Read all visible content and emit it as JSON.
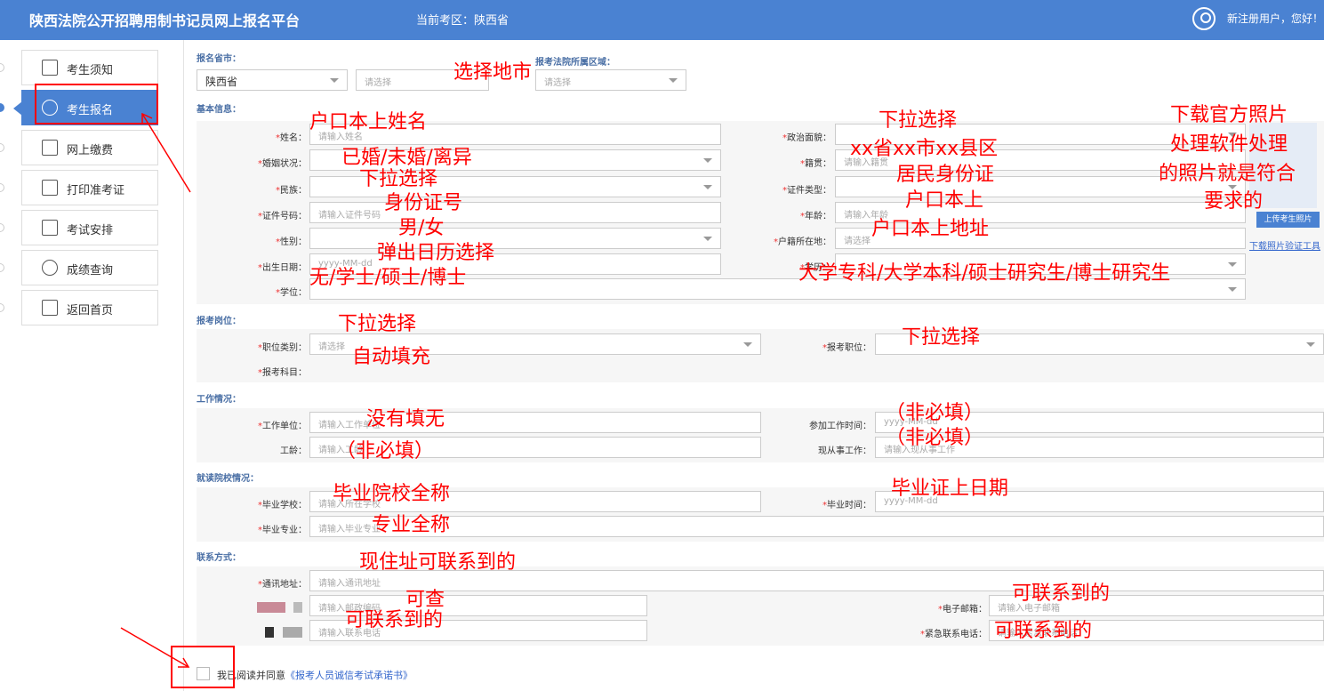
{
  "header": {
    "title": "陕西法院公开招聘用制书记员网上报名平台",
    "district": "当前考区：陕西省",
    "greeting": "新注册用户，您好！"
  },
  "sidebar": {
    "items": [
      {
        "label": "考生须知"
      },
      {
        "label": "考生报名"
      },
      {
        "label": "网上缴费"
      },
      {
        "label": "打印准考证"
      },
      {
        "label": "考试安排"
      },
      {
        "label": "成绩查询"
      },
      {
        "label": "返回首页"
      }
    ]
  },
  "form": {
    "province": {
      "label": "报名省市：",
      "value": "陕西省",
      "city_placeholder": "请选择"
    },
    "court": {
      "label": "报考法院所属区域：",
      "placeholder": "请选择"
    },
    "sections": {
      "basic": "基本信息：",
      "position": "报考岗位：",
      "work": "工作情况：",
      "school": "就读院校情况：",
      "contact": "联系方式："
    },
    "fields": {
      "name": {
        "label": "姓名：",
        "placeholder": "请输入姓名"
      },
      "politics": {
        "label": "政治面貌："
      },
      "marital": {
        "label": "婚姻状况："
      },
      "native": {
        "label": "籍贯：",
        "placeholder": "请输入籍贯"
      },
      "ethnic": {
        "label": "民族："
      },
      "idtype": {
        "label": "证件类型："
      },
      "idno": {
        "label": "证件号码：",
        "placeholder": "请输入证件号码"
      },
      "age": {
        "label": "年龄：",
        "placeholder": "请输入年龄"
      },
      "gender": {
        "label": "性别："
      },
      "hukou": {
        "label": "户籍所在地：",
        "placeholder": "请选择"
      },
      "birth": {
        "label": "出生日期：",
        "placeholder": "yyyy-MM-dd"
      },
      "edu": {
        "label": "学历："
      },
      "degree": {
        "label": "学位："
      },
      "postcat": {
        "label": "职位类别：",
        "placeholder": "请选择"
      },
      "post": {
        "label": "报考职位："
      },
      "subject": {
        "label": "报考科目："
      },
      "employer": {
        "label": "工作单位：",
        "placeholder": "请输入工作单位"
      },
      "workstart": {
        "label": "参加工作时间：",
        "placeholder": "yyyy-MM-dd"
      },
      "seniority": {
        "label": "工龄：",
        "placeholder": "请输入工龄"
      },
      "curwork": {
        "label": "现从事工作：",
        "placeholder": "请输入现从事工作"
      },
      "school": {
        "label": "毕业学校：",
        "placeholder": "请输入所在学校"
      },
      "gradtime": {
        "label": "毕业时间：",
        "placeholder": "yyyy-MM-dd"
      },
      "major": {
        "label": "毕业专业：",
        "placeholder": "请输入毕业专业"
      },
      "address": {
        "label": "通讯地址：",
        "placeholder": "请输入通讯地址"
      },
      "zip": {
        "placeholder": "请输入邮政编码"
      },
      "email": {
        "label": "电子邮箱：",
        "placeholder": "请输入电子邮箱"
      },
      "phone": {
        "placeholder": "请输入联系电话"
      },
      "emergency": {
        "label": "紧急联系电话：",
        "placeholder": "请输入紧急联系电话"
      }
    },
    "photo": {
      "upload": "上传考生照片",
      "download": "下载照片验证工具"
    },
    "agree": {
      "text": "我已阅读并同意",
      "link": "《报考人员诚信考试承诺书》"
    }
  },
  "annotations": [
    "选择地市",
    "户口本上姓名",
    "已婚/未婚/离异",
    "下拉选择",
    "身份证号",
    "男/女",
    "弹出日历选择",
    "无/学士/硕士/博士",
    "下拉选择",
    "xx省xx市xx县区",
    "居民身份证",
    "户口本上",
    "户口本上地址",
    "大学专科/大学本科/硕士研究生/博士研究生",
    "下载官方照片",
    "处理软件处理",
    "的照片就是符合",
    "要求的",
    "下拉选择",
    "自动填充",
    "下拉选择",
    "没有填无",
    "（非必填）",
    "（非必填）",
    "（非必填）",
    "毕业院校全称",
    "专业全称",
    "毕业证上日期",
    "现住址可联系到的",
    "可查",
    "可联系到的",
    "可联系到的",
    "可联系到的"
  ],
  "colors": {
    "primary": "#4a82d2",
    "annotation": "#ff0000"
  }
}
